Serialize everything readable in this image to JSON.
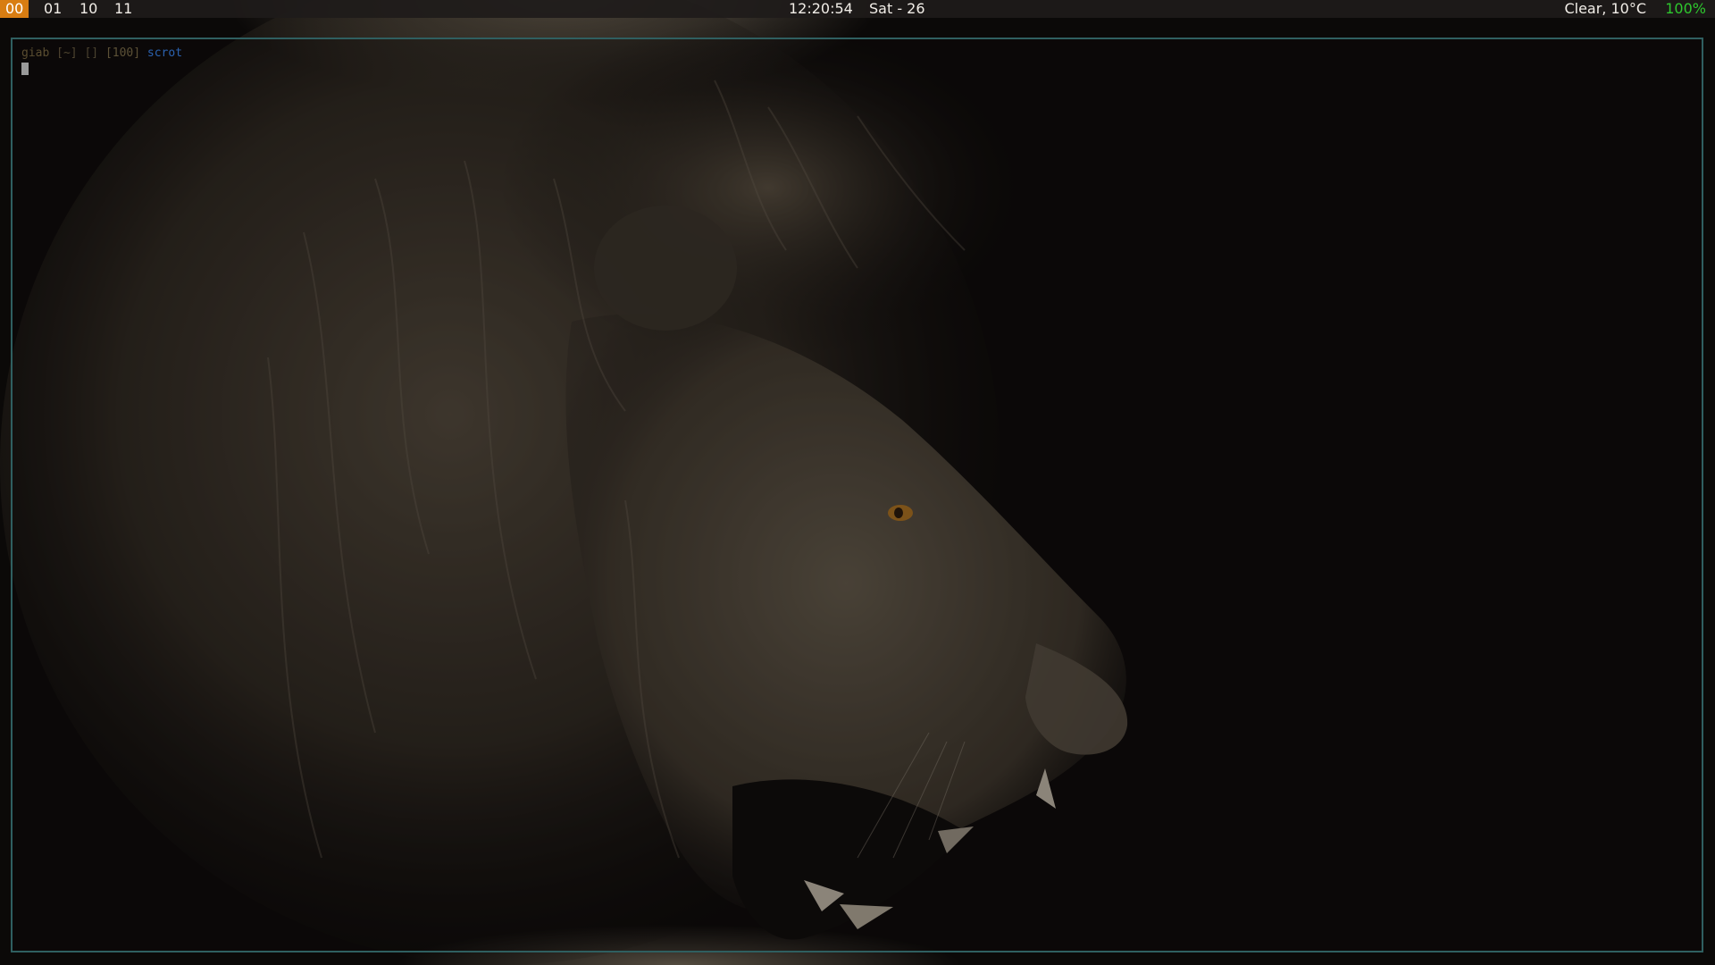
{
  "topbar": {
    "workspaces": [
      "00",
      "01",
      "10",
      "11"
    ],
    "active_workspace": "00",
    "clock": "12:20:54",
    "date": "Sat - 26",
    "weather": "Clear, 10°C",
    "battery": "100%",
    "colors": {
      "active_workspace_bg": "#d87d12",
      "battery_text": "#2ec82e"
    }
  },
  "terminal": {
    "prompt": {
      "user": "giab",
      "path": "[~]",
      "git": "[]",
      "exit_code": "[100]",
      "command": "scrot"
    },
    "border_color": "#2f5f60"
  },
  "wallpaper": {
    "subject": "roaring lion in profile",
    "palette": [
      "#0b0908",
      "#5a4f40",
      "#8c7f6c",
      "#c8892a"
    ]
  }
}
